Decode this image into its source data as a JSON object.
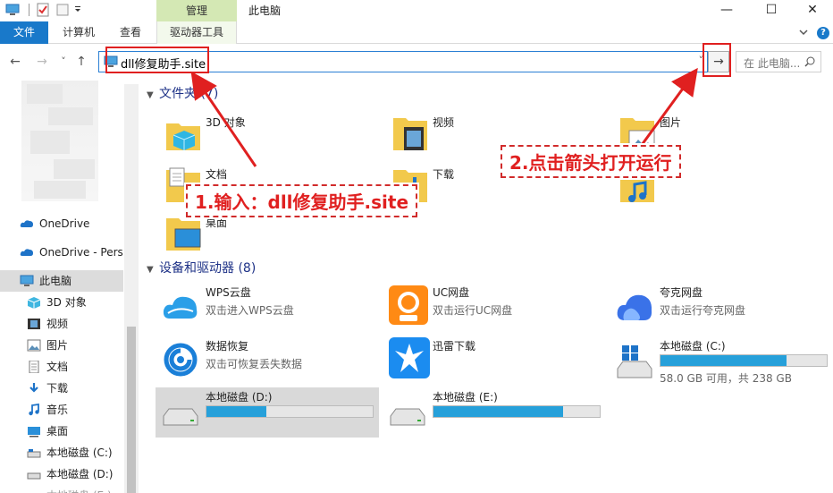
{
  "window": {
    "title": "此电脑",
    "contextual_tab_header": "管理",
    "minimize": "—",
    "maximize": "☐",
    "close": "✕"
  },
  "ribbon": {
    "tabs": [
      {
        "label": "文件"
      },
      {
        "label": "计算机"
      },
      {
        "label": "查看"
      },
      {
        "label": "驱动器工具"
      }
    ],
    "help": "?"
  },
  "nav": {
    "back": "←",
    "forward": "→",
    "recent": "˅",
    "up": "↑",
    "address_value": "dll修复助手.site",
    "address_dropdown": "˅",
    "go": "→",
    "search_placeholder": "在 此电脑..."
  },
  "sidebar": {
    "items": [
      {
        "label": "OneDrive",
        "icon": "cloud-icon"
      },
      {
        "label": "OneDrive - Perso",
        "icon": "cloud-icon"
      },
      {
        "label": "此电脑",
        "icon": "computer-icon",
        "selected": true
      },
      {
        "label": "3D 对象",
        "icon": "cube-icon"
      },
      {
        "label": "视频",
        "icon": "video-icon"
      },
      {
        "label": "图片",
        "icon": "picture-icon"
      },
      {
        "label": "文档",
        "icon": "document-icon"
      },
      {
        "label": "下载",
        "icon": "download-icon"
      },
      {
        "label": "音乐",
        "icon": "music-icon"
      },
      {
        "label": "桌面",
        "icon": "desktop-icon"
      },
      {
        "label": "本地磁盘 (C:)",
        "icon": "drive-icon"
      },
      {
        "label": "本地磁盘 (D:)",
        "icon": "drive-icon"
      },
      {
        "label": "本地磁盘 (E:)",
        "icon": "drive-icon"
      }
    ]
  },
  "folders_section": {
    "title": "文件夹 (7)",
    "items": [
      {
        "label": "3D 对象",
        "icon": "cube-folder-icon"
      },
      {
        "label": "视频",
        "icon": "video-folder-icon"
      },
      {
        "label": "图片",
        "icon": "picture-folder-icon"
      },
      {
        "label": "文档",
        "icon": "document-folder-icon"
      },
      {
        "label": "下载",
        "icon": "download-folder-icon"
      },
      {
        "label": "音乐",
        "icon": "music-folder-icon"
      },
      {
        "label": "桌面",
        "icon": "desktop-folder-icon"
      }
    ]
  },
  "devices_section": {
    "title": "设备和驱动器 (8)",
    "items": [
      {
        "name": "WPS云盘",
        "sub": "双击进入WPS云盘",
        "icon": "wps-cloud-icon"
      },
      {
        "name": "UC网盘",
        "sub": "双击运行UC网盘",
        "icon": "uc-drive-icon"
      },
      {
        "name": "夸克网盘",
        "sub": "双击运行夸克网盘",
        "icon": "quark-cloud-icon"
      },
      {
        "name": "数据恢复",
        "sub": "双击可恢复丢失数据",
        "icon": "data-recovery-icon"
      },
      {
        "name": "迅雷下载",
        "sub": "",
        "icon": "xunlei-icon"
      },
      {
        "name": "本地磁盘 (C:)",
        "free_text": "58.0 GB 可用，共 238 GB",
        "used_fraction": 0.76,
        "icon": "drive-c-icon"
      },
      {
        "name": "本地磁盘 (D:)",
        "used_fraction": 0.36,
        "icon": "drive-d-icon",
        "selected": true
      },
      {
        "name": "本地磁盘 (E:)",
        "used_fraction": 0.78,
        "icon": "drive-e-icon"
      }
    ]
  },
  "annotations": {
    "step1": "1.输入：dll修复助手.site",
    "step2": "2.点击箭头打开运行"
  },
  "colors": {
    "accent": "#1979ca",
    "annotation_red": "#e02020",
    "drive_bar": "#26a0da",
    "context_tab": "#d4e8b4"
  }
}
